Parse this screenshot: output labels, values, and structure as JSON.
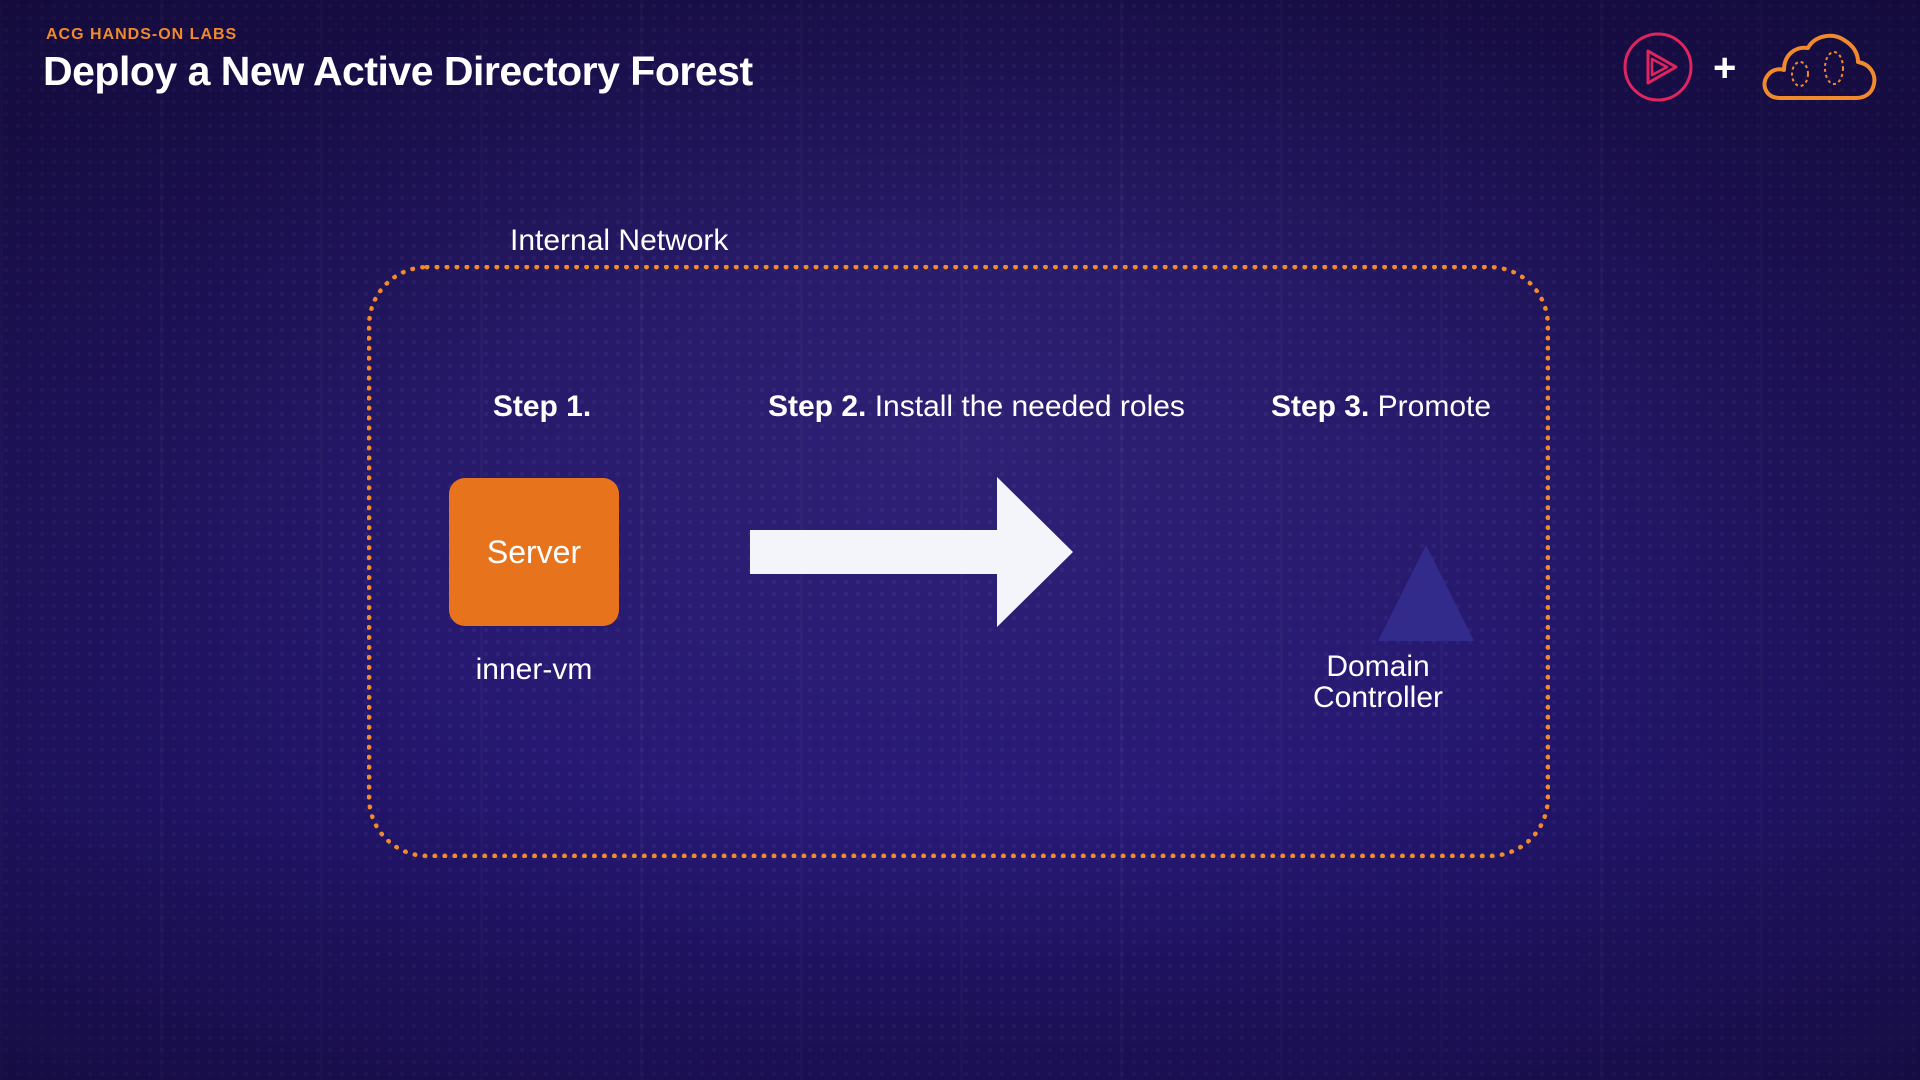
{
  "header": {
    "kicker": "ACG HANDS-ON LABS",
    "title": "Deploy a New Active Directory Forest"
  },
  "logos": {
    "plus": "+",
    "play_icon": "pluralsight-play-icon",
    "cloud_icon": "acloudguru-cloud-icon"
  },
  "diagram": {
    "network_label": "Internal Network",
    "steps": [
      {
        "number": "Step 1.",
        "text": ""
      },
      {
        "number": "Step 2.",
        "text": "Install the needed roles"
      },
      {
        "number": "Step 3.",
        "text": "Promote"
      }
    ],
    "server": {
      "label": "Server",
      "caption": "inner-vm"
    },
    "domain_controller": {
      "caption": "Domain Controller"
    }
  },
  "colors": {
    "accent_orange": "#f08a2d",
    "server_fill": "#e8731d",
    "triangle_fill": "#332b8c",
    "play_logo": "#e0245e",
    "background": "#221565"
  }
}
